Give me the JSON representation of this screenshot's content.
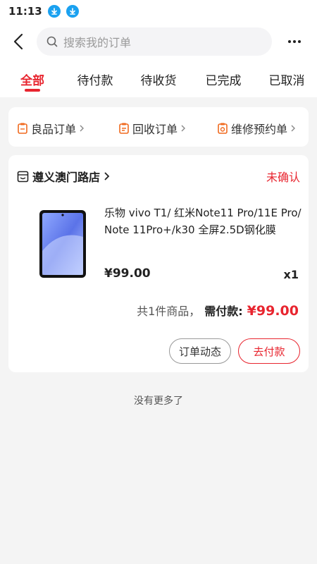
{
  "status_bar": {
    "time": "11:13"
  },
  "header": {
    "search_placeholder": "搜索我的订单"
  },
  "tabs": [
    {
      "label": "全部",
      "active": true
    },
    {
      "label": "待付款",
      "active": false
    },
    {
      "label": "待收货",
      "active": false
    },
    {
      "label": "已完成",
      "active": false
    },
    {
      "label": "已取消",
      "active": false
    }
  ],
  "shortcuts": [
    {
      "label": "良品订单",
      "icon": "clipboard-icon"
    },
    {
      "label": "回收订单",
      "icon": "recycle-order-icon"
    },
    {
      "label": "维修预约单",
      "icon": "repair-icon"
    }
  ],
  "order": {
    "store_name": "遵义澳门路店",
    "status": "未确认",
    "product_title": "乐物 vivo T1/ 红米Note11 Pro/11E Pro/ Note 11Pro+/k30 全屏2.5D钢化膜",
    "price": "¥99.00",
    "qty": "x1",
    "summary_count": "共1件商品，",
    "summary_label": "需付款:",
    "summary_total": "¥99.00",
    "btn_track": "订单动态",
    "btn_pay": "去付款"
  },
  "footer": {
    "no_more": "没有更多了"
  },
  "colors": {
    "accent": "#e8252f",
    "download_badge": "#1aa1f0"
  }
}
